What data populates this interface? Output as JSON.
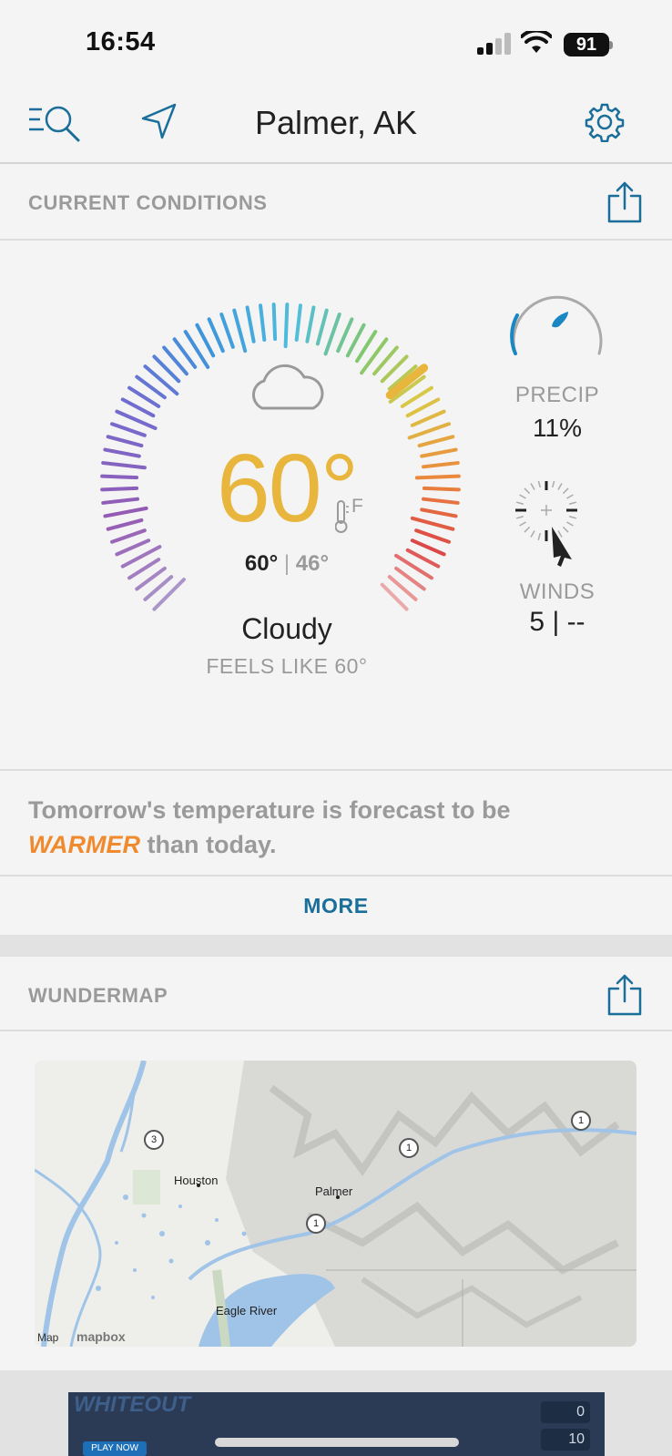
{
  "status_bar": {
    "time": "16:54",
    "battery": "91"
  },
  "nav": {
    "title": "Palmer, AK"
  },
  "current_conditions": {
    "header": "CURRENT CONDITIONS",
    "temperature": "60°",
    "unit": "F",
    "high": "60°",
    "low": "46°",
    "separator": "|",
    "condition": "Cloudy",
    "feels_like": "FEELS LIKE 60°",
    "precip_label": "PRECIP",
    "precip_value": "11%",
    "winds_label": "WINDS",
    "winds_value": "5 | --"
  },
  "forecast": {
    "line1": "Tomorrow's temperature is forecast to be",
    "emphasis": "WARMER",
    "line2": " than today.",
    "more": "MORE"
  },
  "wundermap": {
    "header": "WUNDERMAP",
    "labels": {
      "houston": "Houston",
      "palmer": "Palmer",
      "eagle_river": "Eagle River"
    },
    "routes": [
      "3",
      "1",
      "1",
      "1"
    ],
    "attribution": "Map",
    "mapbox": "mapbox"
  },
  "ad": {
    "title": "WHITEOUT",
    "cta": "PLAY NOW",
    "score1": "0",
    "score2": "10"
  },
  "colors": {
    "accent": "#1a6f9a",
    "temp": "#e8b63d",
    "warmer": "#f08a2e"
  }
}
